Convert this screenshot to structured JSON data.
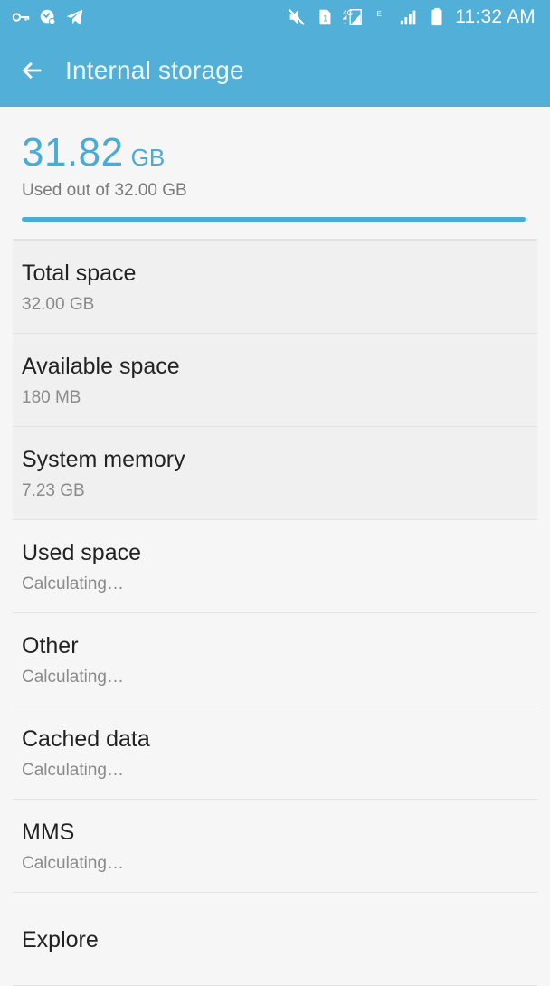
{
  "status_bar": {
    "time": "11:32 AM",
    "left_icons": [
      "key-icon",
      "shield-icon",
      "telegram-icon"
    ],
    "right_icons": [
      "mute-icon",
      "sim-icon",
      "lte-signal-icon",
      "edge-icon",
      "signal-icon",
      "battery-icon"
    ]
  },
  "header": {
    "title": "Internal storage",
    "back_icon": "arrow-left-icon",
    "color": "#52b0d8"
  },
  "summary": {
    "used_number": "31.82",
    "used_unit": "GB",
    "caption": "Used out of 32.00 GB",
    "progress_fraction": 0.994,
    "accent_color": "#4aabd6"
  },
  "items": [
    {
      "title": "Total space",
      "subtitle": "32.00 GB"
    },
    {
      "title": "Available space",
      "subtitle": "180 MB"
    },
    {
      "title": "System memory",
      "subtitle": "7.23 GB"
    },
    {
      "title": "Used space",
      "subtitle": "Calculating…"
    },
    {
      "title": "Other",
      "subtitle": "Calculating…"
    },
    {
      "title": "Cached data",
      "subtitle": "Calculating…"
    },
    {
      "title": "MMS",
      "subtitle": "Calculating…"
    },
    {
      "title": "Explore",
      "subtitle": ""
    }
  ]
}
